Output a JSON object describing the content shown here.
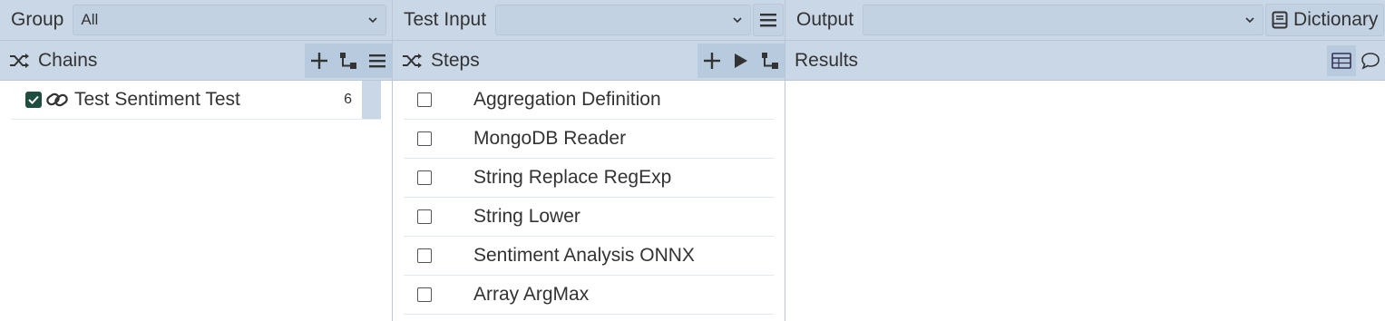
{
  "group": {
    "label": "Group",
    "selected": "All"
  },
  "test_input": {
    "label": "Test Input",
    "selected": ""
  },
  "output": {
    "label": "Output",
    "selected": "",
    "dictionary_label": "Dictionary"
  },
  "chains": {
    "title": "Chains",
    "items": [
      {
        "label": "Test Sentiment Test",
        "count": "6",
        "checked": true
      }
    ]
  },
  "steps": {
    "title": "Steps",
    "items": [
      {
        "label": "Aggregation Definition"
      },
      {
        "label": "MongoDB Reader"
      },
      {
        "label": "String Replace RegExp"
      },
      {
        "label": "String Lower"
      },
      {
        "label": "Sentiment Analysis ONNX"
      },
      {
        "label": "Array ArgMax"
      }
    ]
  },
  "results": {
    "title": "Results"
  }
}
